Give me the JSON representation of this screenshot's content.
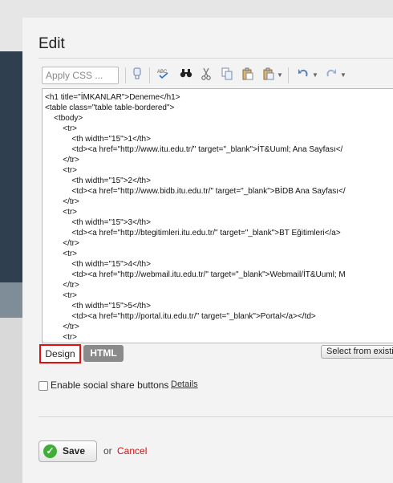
{
  "modal": {
    "title": "Edit"
  },
  "toolbar": {
    "css_select_placeholder": "Apply CSS ...",
    "icons": [
      "clean-icon",
      "spellcheck-icon",
      "find-icon",
      "cut-icon",
      "copy-icon",
      "paste-icon",
      "paste-options-icon",
      "undo-icon",
      "redo-icon"
    ]
  },
  "editor": {
    "lines": [
      "<h1 title=\"İMKANLAR\">Deneme</h1>",
      "<table class=\"table table-bordered\">",
      "    <tbody>",
      "        <tr>",
      "            <th width=\"15\">1</th>",
      "            <td><a href=\"http://www.itu.edu.tr/\" target=\"_blank\">İT&Uuml; Ana Sayfası</",
      "        </tr>",
      "        <tr>",
      "            <th width=\"15\">2</th>",
      "            <td><a href=\"http://www.bidb.itu.edu.tr/\" target=\"_blank\">BİDB Ana Sayfası</",
      "        </tr>",
      "        <tr>",
      "            <th width=\"15\">3</th>",
      "            <td><a href=\"http://btegitimleri.itu.edu.tr/\" target=\"_blank\">BT Eğitimleri</a>",
      "        </tr>",
      "        <tr>",
      "            <th width=\"15\">4</th>",
      "            <td><a href=\"http://webmail.itu.edu.tr/\" target=\"_blank\">Webmail/İT&Uuml; M",
      "        </tr>",
      "        <tr>",
      "            <th width=\"15\">5</th>",
      "            <td><a href=\"http://portal.itu.edu.tr/\" target=\"_blank\">Portal</a></td>",
      "        </tr>",
      "        <tr>"
    ]
  },
  "modebar": {
    "design_label": "Design",
    "html_label": "HTML",
    "select_label": "Select from existi"
  },
  "share": {
    "label": "Enable social share buttons",
    "details_label": "Details",
    "checked": false
  },
  "footer": {
    "save_label": "Save",
    "or_label": "or",
    "cancel_label": "Cancel"
  },
  "colors": {
    "highlight_border": "#e01010",
    "cancel": "#d01010",
    "save_icon": "#3fae35"
  }
}
